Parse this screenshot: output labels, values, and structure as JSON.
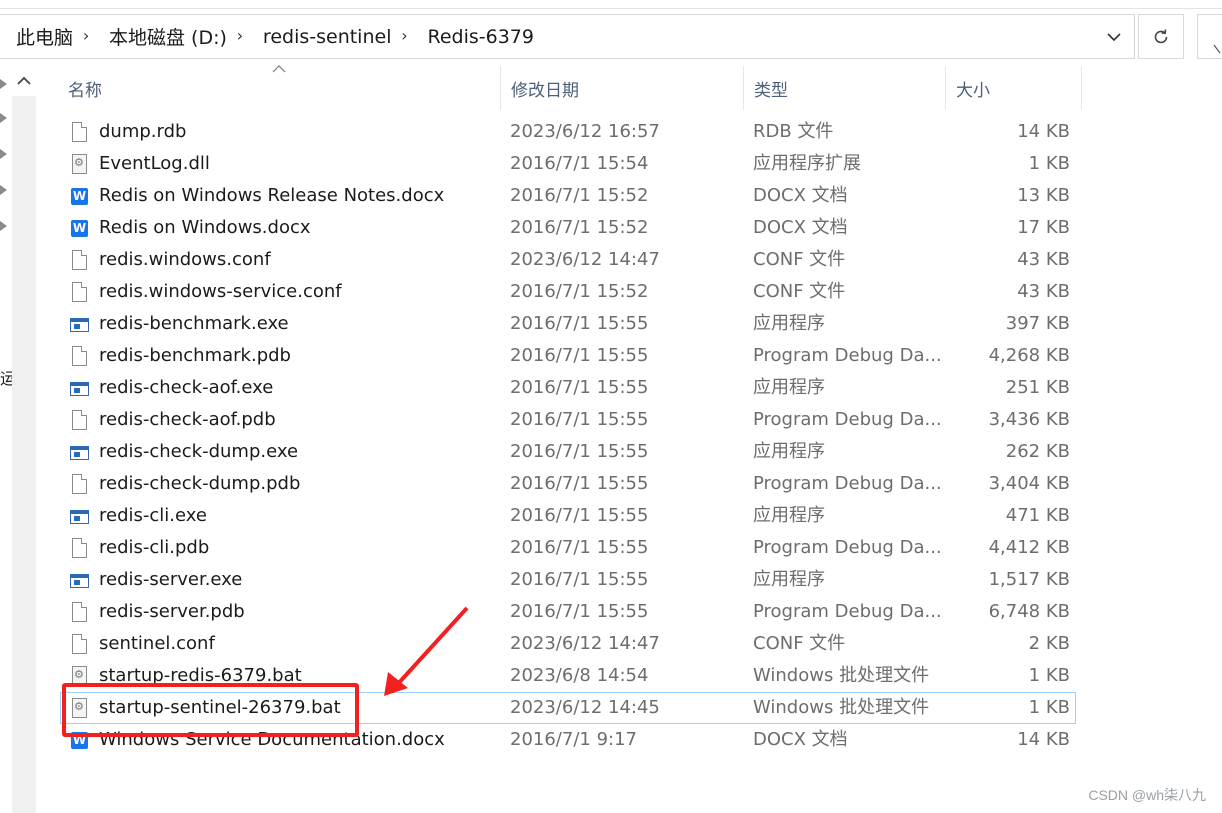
{
  "address_bar": {
    "crumbs": [
      "此电脑",
      "本地磁盘 (D:)",
      "redis-sentinel",
      "Redis-6379"
    ]
  },
  "icons": {
    "dropdown": "chevron-down-icon",
    "refresh": "refresh-icon",
    "sort": "sort-ascending-icon"
  },
  "nav": {
    "stub_label": "运"
  },
  "columns": {
    "name": "名称",
    "date": "修改日期",
    "type": "类型",
    "size": "大小"
  },
  "files": [
    {
      "name": "dump.rdb",
      "date": "2023/6/12 16:57",
      "type": "RDB 文件",
      "size": "14 KB",
      "icon": "file"
    },
    {
      "name": "EventLog.dll",
      "date": "2016/7/1 15:54",
      "type": "应用程序扩展",
      "size": "1 KB",
      "icon": "gear"
    },
    {
      "name": "Redis on Windows Release Notes.docx",
      "date": "2016/7/1 15:52",
      "type": "DOCX 文档",
      "size": "13 KB",
      "icon": "word"
    },
    {
      "name": "Redis on Windows.docx",
      "date": "2016/7/1 15:52",
      "type": "DOCX 文档",
      "size": "17 KB",
      "icon": "word"
    },
    {
      "name": "redis.windows.conf",
      "date": "2023/6/12 14:47",
      "type": "CONF 文件",
      "size": "43 KB",
      "icon": "file"
    },
    {
      "name": "redis.windows-service.conf",
      "date": "2016/7/1 15:52",
      "type": "CONF 文件",
      "size": "43 KB",
      "icon": "file"
    },
    {
      "name": "redis-benchmark.exe",
      "date": "2016/7/1 15:55",
      "type": "应用程序",
      "size": "397 KB",
      "icon": "exe"
    },
    {
      "name": "redis-benchmark.pdb",
      "date": "2016/7/1 15:55",
      "type": "Program Debug Da...",
      "size": "4,268 KB",
      "icon": "file"
    },
    {
      "name": "redis-check-aof.exe",
      "date": "2016/7/1 15:55",
      "type": "应用程序",
      "size": "251 KB",
      "icon": "exe"
    },
    {
      "name": "redis-check-aof.pdb",
      "date": "2016/7/1 15:55",
      "type": "Program Debug Da...",
      "size": "3,436 KB",
      "icon": "file"
    },
    {
      "name": "redis-check-dump.exe",
      "date": "2016/7/1 15:55",
      "type": "应用程序",
      "size": "262 KB",
      "icon": "exe"
    },
    {
      "name": "redis-check-dump.pdb",
      "date": "2016/7/1 15:55",
      "type": "Program Debug Da...",
      "size": "3,404 KB",
      "icon": "file"
    },
    {
      "name": "redis-cli.exe",
      "date": "2016/7/1 15:55",
      "type": "应用程序",
      "size": "471 KB",
      "icon": "exe"
    },
    {
      "name": "redis-cli.pdb",
      "date": "2016/7/1 15:55",
      "type": "Program Debug Da...",
      "size": "4,412 KB",
      "icon": "file"
    },
    {
      "name": "redis-server.exe",
      "date": "2016/7/1 15:55",
      "type": "应用程序",
      "size": "1,517 KB",
      "icon": "exe"
    },
    {
      "name": "redis-server.pdb",
      "date": "2016/7/1 15:55",
      "type": "Program Debug Da...",
      "size": "6,748 KB",
      "icon": "file"
    },
    {
      "name": "sentinel.conf",
      "date": "2023/6/12 14:47",
      "type": "CONF 文件",
      "size": "2 KB",
      "icon": "file"
    },
    {
      "name": "startup-redis-6379.bat",
      "date": "2023/6/8 14:54",
      "type": "Windows 批处理文件",
      "size": "1 KB",
      "icon": "gear"
    },
    {
      "name": "startup-sentinel-26379.bat",
      "date": "2023/6/12 14:45",
      "type": "Windows 批处理文件",
      "size": "1 KB",
      "icon": "gear",
      "selected": true
    },
    {
      "name": "Windows Service Documentation.docx",
      "date": "2016/7/1 9:17",
      "type": "DOCX 文档",
      "size": "14 KB",
      "icon": "word"
    }
  ],
  "annotation": {
    "highlight_color": "#f42020"
  },
  "watermark": "CSDN @wh柒八九"
}
